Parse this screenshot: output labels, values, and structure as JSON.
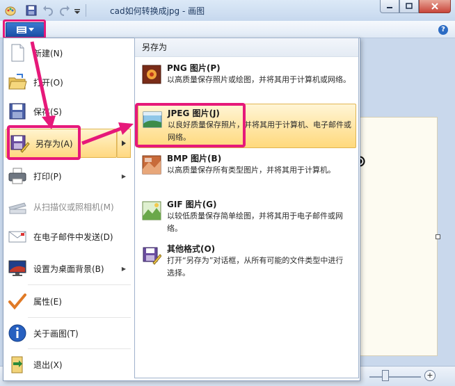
{
  "window": {
    "title": "cad如何转换成jpg - 画图",
    "buttons": [
      "minimize",
      "maximize",
      "close"
    ]
  },
  "ribbon": {
    "help": "?"
  },
  "menu": {
    "items": [
      {
        "label": "新建(N)",
        "icon": "new-file-icon",
        "has_submenu": false,
        "enabled": true
      },
      {
        "label": "打开(O)",
        "icon": "open-folder-icon",
        "has_submenu": false,
        "enabled": true
      },
      {
        "label": "保存(S)",
        "icon": "save-icon",
        "has_submenu": false,
        "enabled": true
      },
      {
        "label": "另存为(A)",
        "icon": "save-as-icon",
        "has_submenu": true,
        "enabled": true,
        "active": true
      },
      {
        "label": "打印(P)",
        "icon": "printer-icon",
        "has_submenu": true,
        "enabled": true
      },
      {
        "label": "从扫描仪或照相机(M)",
        "icon": "scanner-icon",
        "has_submenu": false,
        "enabled": false
      },
      {
        "label": "在电子邮件中发送(D)",
        "icon": "email-icon",
        "has_submenu": false,
        "enabled": true
      },
      {
        "label": "设置为桌面背景(B)",
        "icon": "desktop-background-icon",
        "has_submenu": true,
        "enabled": true
      },
      {
        "label": "属性(E)",
        "icon": "properties-check-icon",
        "has_submenu": false,
        "enabled": true
      },
      {
        "label": "关于画图(T)",
        "icon": "info-icon",
        "has_submenu": false,
        "enabled": true
      },
      {
        "label": "退出(X)",
        "icon": "exit-icon",
        "has_submenu": false,
        "enabled": true
      }
    ]
  },
  "submenu": {
    "header": "另存为",
    "items": [
      {
        "title": "PNG 图片(P)",
        "desc": "以高质量保存照片或绘图，并将其用于计算机或网络。",
        "icon": "png-image-icon"
      },
      {
        "title": "JPEG 图片(J)",
        "desc": "以良好质量保存照片，并将其用于计算机、电子邮件或网络。",
        "icon": "jpeg-image-icon",
        "active": true
      },
      {
        "title": "BMP 图片(B)",
        "desc": "以高质量保存所有类型图片，并将其用于计算机。",
        "icon": "bmp-image-icon"
      },
      {
        "title": "GIF 图片(G)",
        "desc": "以较低质量保存简单绘图，并将其用于电子邮件或网络。",
        "icon": "gif-image-icon"
      },
      {
        "title": "其他格式(O)",
        "desc": "打开“另存为”对话框，从所有可能的文件类型中进行选择。",
        "icon": "other-formats-icon"
      }
    ]
  },
  "colors": {
    "highlight": "#e6197a",
    "menu_hover": "#ffd880",
    "app_button": "#1a4fa6"
  }
}
